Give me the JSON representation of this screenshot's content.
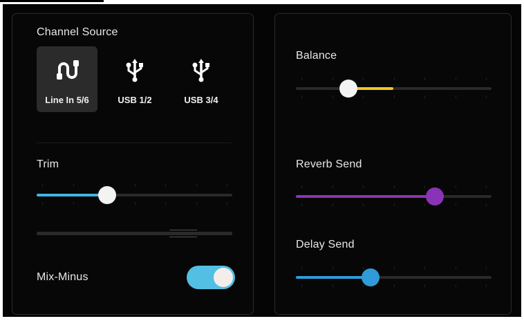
{
  "channel_source": {
    "title": "Channel Source",
    "options": [
      {
        "label": "Line In 5/6",
        "icon": "line-in-icon",
        "selected": true
      },
      {
        "label": "USB 1/2",
        "icon": "usb-icon",
        "selected": false
      },
      {
        "label": "USB 3/4",
        "icon": "usb-icon",
        "selected": false
      }
    ]
  },
  "trim": {
    "label": "Trim",
    "value_percent": 36,
    "color": "#3fb6e4"
  },
  "mix_minus": {
    "label": "Mix-Minus",
    "on": true,
    "color": "#52bfe3"
  },
  "balance": {
    "label": "Balance",
    "value_percent": 27,
    "center_percent": 50,
    "color": "#f2c623"
  },
  "reverb_send": {
    "label": "Reverb Send",
    "value_percent": 71,
    "color": "#8a33b6"
  },
  "delay_send": {
    "label": "Delay Send",
    "value_percent": 38,
    "color": "#2f9bd8"
  }
}
